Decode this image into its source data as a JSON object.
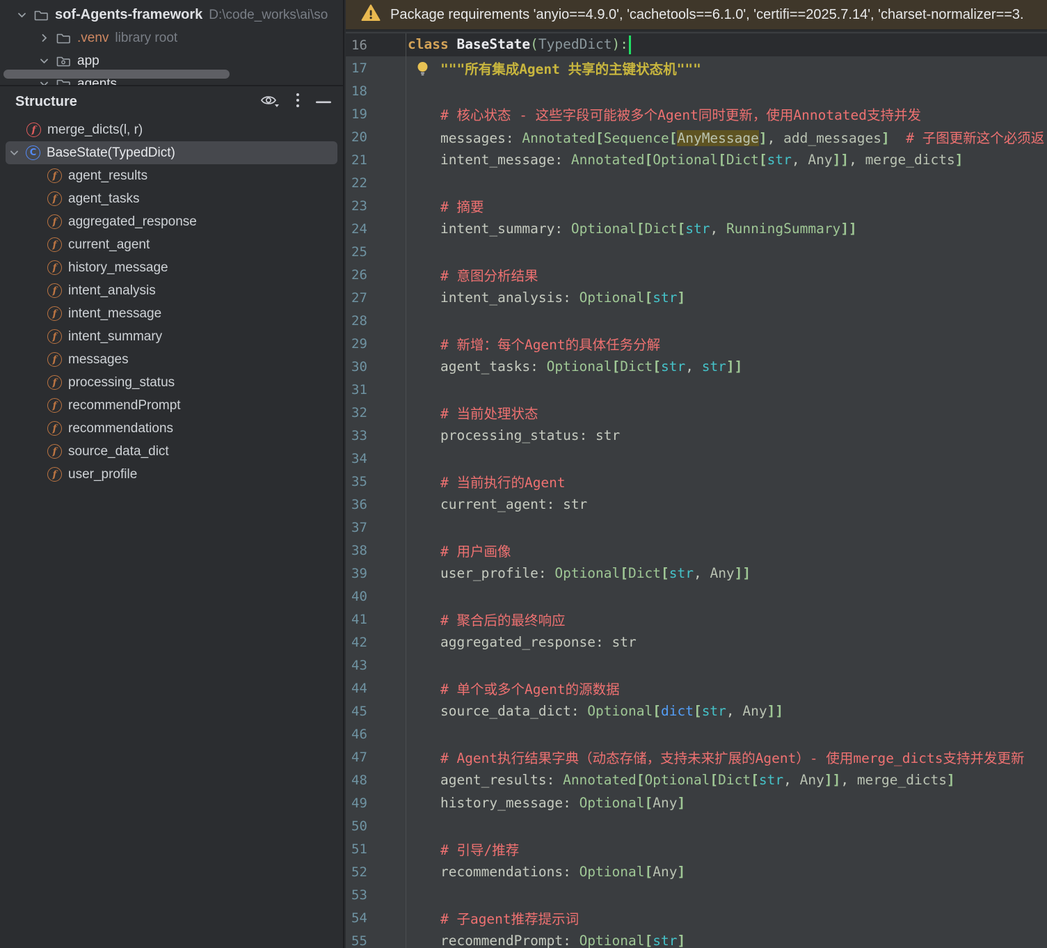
{
  "project": {
    "rows": [
      {
        "label": "sof-Agents-framework",
        "suffix": "D:\\code_works\\ai\\so",
        "chevron": "down",
        "icon": "folder",
        "bold": true,
        "pad": 24
      },
      {
        "label": ".venv",
        "suffix": "library root",
        "chevron": "right",
        "icon": "folder",
        "accent": true,
        "pad": 56
      },
      {
        "label": "app",
        "chevron": "down",
        "icon": "package",
        "pad": 56
      },
      {
        "label": "agents",
        "chevron": "down",
        "icon": "folder",
        "pad": 56
      }
    ]
  },
  "structure": {
    "title": "Structure",
    "icon_glyphs": {
      "function": "f",
      "class": "C",
      "property": "f"
    },
    "items": [
      {
        "icon": "fn",
        "glyph": "f",
        "label": "merge_dicts(l, r)",
        "level": 1
      },
      {
        "icon": "cls",
        "glyph": "C",
        "label": "BaseState(TypedDict)",
        "level": 0,
        "chevron": true,
        "selected": true
      },
      {
        "icon": "prop",
        "glyph": "f",
        "label": "agent_results",
        "level": 2
      },
      {
        "icon": "prop",
        "glyph": "f",
        "label": "agent_tasks",
        "level": 2
      },
      {
        "icon": "prop",
        "glyph": "f",
        "label": "aggregated_response",
        "level": 2
      },
      {
        "icon": "prop",
        "glyph": "f",
        "label": "current_agent",
        "level": 2
      },
      {
        "icon": "prop",
        "glyph": "f",
        "label": "history_message",
        "level": 2
      },
      {
        "icon": "prop",
        "glyph": "f",
        "label": "intent_analysis",
        "level": 2
      },
      {
        "icon": "prop",
        "glyph": "f",
        "label": "intent_message",
        "level": 2
      },
      {
        "icon": "prop",
        "glyph": "f",
        "label": "intent_summary",
        "level": 2
      },
      {
        "icon": "prop",
        "glyph": "f",
        "label": "messages",
        "level": 2
      },
      {
        "icon": "prop",
        "glyph": "f",
        "label": "processing_status",
        "level": 2
      },
      {
        "icon": "prop",
        "glyph": "f",
        "label": "recommendPrompt",
        "level": 2
      },
      {
        "icon": "prop",
        "glyph": "f",
        "label": "recommendations",
        "level": 2
      },
      {
        "icon": "prop",
        "glyph": "f",
        "label": "source_data_dict",
        "level": 2
      },
      {
        "icon": "prop",
        "glyph": "f",
        "label": "user_profile",
        "level": 2
      }
    ]
  },
  "banner": {
    "text": "Package requirements 'anyio==4.9.0', 'cachetools==6.1.0', 'certifi==2025.7.14', 'charset-normalizer==3."
  },
  "colors": {
    "editor_bg": "#3a3d40",
    "caret_line_bg": "#2a2c2f",
    "panel_bg": "#2b2d30",
    "banner_bg": "#3f372a",
    "warning_amber": "#e9b950",
    "comment_red": "#ee7171",
    "docstring_yellow": "#c8b63e",
    "keyword_gold": "#d5a458",
    "type_green": "#9fc795",
    "str_cyan": "#45c2c8",
    "builtin_blue": "#539df5",
    "caret_green": "#21e065",
    "fn_icon_red": "#e05c5c",
    "class_icon_blue": "#548af7",
    "field_icon_orange": "#bb7442"
  },
  "editor": {
    "lines": [
      {
        "n": 16,
        "current": true,
        "tokens": [
          [
            "kw",
            "class"
          ],
          [
            "pln",
            " "
          ],
          [
            "cls",
            "BaseState"
          ],
          [
            "pr",
            "("
          ],
          [
            "tmut",
            "TypedDict"
          ],
          [
            "pr",
            "):"
          ],
          [
            "caret",
            ""
          ]
        ]
      },
      {
        "n": 17,
        "bulb": true,
        "tokens": [
          [
            "ind",
            "    "
          ],
          [
            "doc",
            "\"\"\"所有集成Agent 共享的主键状态机\"\"\""
          ]
        ]
      },
      {
        "n": 18,
        "tokens": []
      },
      {
        "n": 19,
        "tokens": [
          [
            "ind",
            "    "
          ],
          [
            "cm",
            "# 核心状态 - 这些字段可能被多个Agent同时更新，使用Annotated支持并发"
          ]
        ]
      },
      {
        "n": 20,
        "tokens": [
          [
            "ind",
            "    "
          ],
          [
            "fld",
            "messages"
          ],
          [
            "pun",
            ": "
          ],
          [
            "typ",
            "Annotated"
          ],
          [
            "br",
            "["
          ],
          [
            "typ",
            "Sequence"
          ],
          [
            "br",
            "["
          ],
          [
            "hl",
            "AnyMessage"
          ],
          [
            "br",
            "]"
          ],
          [
            "pun",
            ", "
          ],
          [
            "idf",
            "add_messages"
          ],
          [
            "br",
            "]"
          ],
          [
            "pln",
            "  "
          ],
          [
            "cm",
            "# 子图更新这个必须返"
          ]
        ]
      },
      {
        "n": 21,
        "tokens": [
          [
            "ind",
            "    "
          ],
          [
            "fld",
            "intent_message"
          ],
          [
            "pun",
            ": "
          ],
          [
            "typ",
            "Annotated"
          ],
          [
            "br",
            "["
          ],
          [
            "typ",
            "Optional"
          ],
          [
            "br",
            "["
          ],
          [
            "typ",
            "Dict"
          ],
          [
            "br",
            "["
          ],
          [
            "str",
            "str"
          ],
          [
            "pun",
            ", "
          ],
          [
            "idf",
            "Any"
          ],
          [
            "br",
            "]]"
          ],
          [
            "pun",
            ", "
          ],
          [
            "idf",
            "merge_dicts"
          ],
          [
            "br",
            "]"
          ]
        ]
      },
      {
        "n": 22,
        "tokens": []
      },
      {
        "n": 23,
        "tokens": [
          [
            "ind",
            "    "
          ],
          [
            "cm",
            "# 摘要"
          ]
        ]
      },
      {
        "n": 24,
        "tokens": [
          [
            "ind",
            "    "
          ],
          [
            "fld",
            "intent_summary"
          ],
          [
            "pun",
            ": "
          ],
          [
            "typ",
            "Optional"
          ],
          [
            "br",
            "["
          ],
          [
            "typ",
            "Dict"
          ],
          [
            "br",
            "["
          ],
          [
            "str",
            "str"
          ],
          [
            "pun",
            ", "
          ],
          [
            "typ",
            "RunningSummary"
          ],
          [
            "br",
            "]]"
          ]
        ]
      },
      {
        "n": 25,
        "tokens": []
      },
      {
        "n": 26,
        "tokens": [
          [
            "ind",
            "    "
          ],
          [
            "cm",
            "# 意图分析结果"
          ]
        ]
      },
      {
        "n": 27,
        "tokens": [
          [
            "ind",
            "    "
          ],
          [
            "fld",
            "intent_analysis"
          ],
          [
            "pun",
            ": "
          ],
          [
            "typ",
            "Optional"
          ],
          [
            "br",
            "["
          ],
          [
            "str",
            "str"
          ],
          [
            "br",
            "]"
          ]
        ]
      },
      {
        "n": 28,
        "tokens": []
      },
      {
        "n": 29,
        "tokens": [
          [
            "ind",
            "    "
          ],
          [
            "cm",
            "# 新增：每个Agent的具体任务分解"
          ]
        ]
      },
      {
        "n": 30,
        "tokens": [
          [
            "ind",
            "    "
          ],
          [
            "fld",
            "agent_tasks"
          ],
          [
            "pun",
            ": "
          ],
          [
            "typ",
            "Optional"
          ],
          [
            "br",
            "["
          ],
          [
            "typ",
            "Dict"
          ],
          [
            "br",
            "["
          ],
          [
            "str",
            "str"
          ],
          [
            "pun",
            ", "
          ],
          [
            "str",
            "str"
          ],
          [
            "br",
            "]]"
          ]
        ]
      },
      {
        "n": 31,
        "tokens": []
      },
      {
        "n": 32,
        "tokens": [
          [
            "ind",
            "    "
          ],
          [
            "cm",
            "# 当前处理状态"
          ]
        ]
      },
      {
        "n": 33,
        "tokens": [
          [
            "ind",
            "    "
          ],
          [
            "fld",
            "processing_status"
          ],
          [
            "pun",
            ": "
          ],
          [
            "fld",
            "str"
          ]
        ]
      },
      {
        "n": 34,
        "tokens": []
      },
      {
        "n": 35,
        "tokens": [
          [
            "ind",
            "    "
          ],
          [
            "cm",
            "# 当前执行的Agent"
          ]
        ]
      },
      {
        "n": 36,
        "tokens": [
          [
            "ind",
            "    "
          ],
          [
            "fld",
            "current_agent"
          ],
          [
            "pun",
            ": "
          ],
          [
            "fld",
            "str"
          ]
        ]
      },
      {
        "n": 37,
        "tokens": []
      },
      {
        "n": 38,
        "tokens": [
          [
            "ind",
            "    "
          ],
          [
            "cm",
            "# 用户画像"
          ]
        ]
      },
      {
        "n": 39,
        "tokens": [
          [
            "ind",
            "    "
          ],
          [
            "fld",
            "user_profile"
          ],
          [
            "pun",
            ": "
          ],
          [
            "typ",
            "Optional"
          ],
          [
            "br",
            "["
          ],
          [
            "typ",
            "Dict"
          ],
          [
            "br",
            "["
          ],
          [
            "str",
            "str"
          ],
          [
            "pun",
            ", "
          ],
          [
            "idf",
            "Any"
          ],
          [
            "br",
            "]]"
          ]
        ]
      },
      {
        "n": 40,
        "tokens": []
      },
      {
        "n": 41,
        "tokens": [
          [
            "ind",
            "    "
          ],
          [
            "cm",
            "# 聚合后的最终响应"
          ]
        ]
      },
      {
        "n": 42,
        "tokens": [
          [
            "ind",
            "    "
          ],
          [
            "fld",
            "aggregated_response"
          ],
          [
            "pun",
            ": "
          ],
          [
            "fld",
            "str"
          ]
        ]
      },
      {
        "n": 43,
        "tokens": []
      },
      {
        "n": 44,
        "tokens": [
          [
            "ind",
            "    "
          ],
          [
            "cm",
            "# 单个或多个Agent的源数据"
          ]
        ]
      },
      {
        "n": 45,
        "tokens": [
          [
            "ind",
            "    "
          ],
          [
            "fld",
            "source_data_dict"
          ],
          [
            "pun",
            ": "
          ],
          [
            "typ",
            "Optional"
          ],
          [
            "br",
            "["
          ],
          [
            "blt",
            "dict"
          ],
          [
            "br",
            "["
          ],
          [
            "str",
            "str"
          ],
          [
            "pun",
            ", "
          ],
          [
            "idf",
            "Any"
          ],
          [
            "br",
            "]]"
          ]
        ]
      },
      {
        "n": 46,
        "tokens": []
      },
      {
        "n": 47,
        "tokens": [
          [
            "ind",
            "    "
          ],
          [
            "cm",
            "# Agent执行结果字典（动态存储，支持未来扩展的Agent）- 使用merge_dicts支持并发更新"
          ]
        ]
      },
      {
        "n": 48,
        "tokens": [
          [
            "ind",
            "    "
          ],
          [
            "fld",
            "agent_results"
          ],
          [
            "pun",
            ": "
          ],
          [
            "typ",
            "Annotated"
          ],
          [
            "br",
            "["
          ],
          [
            "typ",
            "Optional"
          ],
          [
            "br",
            "["
          ],
          [
            "typ",
            "Dict"
          ],
          [
            "br",
            "["
          ],
          [
            "str",
            "str"
          ],
          [
            "pun",
            ", "
          ],
          [
            "idf",
            "Any"
          ],
          [
            "br",
            "]]"
          ],
          [
            "pun",
            ", "
          ],
          [
            "idf",
            "merge_dicts"
          ],
          [
            "br",
            "]"
          ]
        ]
      },
      {
        "n": 49,
        "tokens": [
          [
            "ind",
            "    "
          ],
          [
            "fld",
            "history_message"
          ],
          [
            "pun",
            ": "
          ],
          [
            "typ",
            "Optional"
          ],
          [
            "br",
            "["
          ],
          [
            "idf",
            "Any"
          ],
          [
            "br",
            "]"
          ]
        ]
      },
      {
        "n": 50,
        "tokens": []
      },
      {
        "n": 51,
        "tokens": [
          [
            "ind",
            "    "
          ],
          [
            "cm",
            "# 引导/推荐"
          ]
        ]
      },
      {
        "n": 52,
        "tokens": [
          [
            "ind",
            "    "
          ],
          [
            "fld",
            "recommendations"
          ],
          [
            "pun",
            ": "
          ],
          [
            "typ",
            "Optional"
          ],
          [
            "br",
            "["
          ],
          [
            "idf",
            "Any"
          ],
          [
            "br",
            "]"
          ]
        ]
      },
      {
        "n": 53,
        "tokens": []
      },
      {
        "n": 54,
        "tokens": [
          [
            "ind",
            "    "
          ],
          [
            "cm",
            "# 子agent推荐提示词"
          ]
        ]
      },
      {
        "n": 55,
        "tokens": [
          [
            "ind",
            "    "
          ],
          [
            "fld",
            "recommendPrompt"
          ],
          [
            "pun",
            ": "
          ],
          [
            "typ",
            "Optional"
          ],
          [
            "br",
            "["
          ],
          [
            "str",
            "str"
          ],
          [
            "br",
            "]"
          ]
        ]
      }
    ]
  }
}
